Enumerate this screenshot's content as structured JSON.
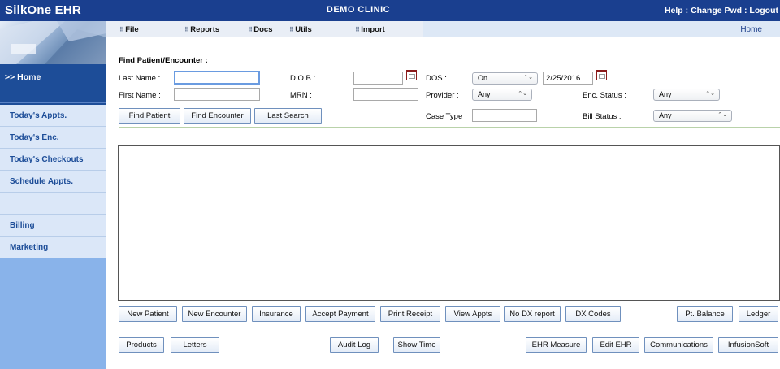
{
  "topbar": {
    "brand": "SilkOne  EHR",
    "clinic": "DEMO  CLINIC",
    "help": "Help",
    "sep1": " : ",
    "change_pwd": "Change Pwd",
    "sep2": " : ",
    "logout": "Logout"
  },
  "menubar": {
    "items": [
      "File",
      "Reports",
      "Docs",
      "Utils",
      "Import"
    ],
    "home": "Home"
  },
  "sidebar": {
    "home": ">> Home",
    "items": [
      "Today's Appts.",
      "Today's Enc.",
      "Today's Checkouts",
      "Schedule Appts.",
      "",
      "Billing",
      "Marketing"
    ]
  },
  "form": {
    "title": "Find Patient/Encounter :",
    "last_name_label": "Last Name :",
    "first_name_label": "First Name :",
    "dob_label": "D O B :",
    "mrn_label": "MRN :",
    "dos_label": "DOS :",
    "dos_mode": "On",
    "dos_date": "2/25/2016",
    "provider_label": "Provider :",
    "provider_value": "Any",
    "enc_status_label": "Enc. Status :",
    "enc_status_value": "Any",
    "case_type_label": "Case Type",
    "bill_status_label": "Bill Status :",
    "bill_status_value": "Any",
    "find_patient": "Find Patient",
    "find_encounter": "Find Encounter",
    "last_search": "Last Search"
  },
  "actions_row1": [
    "New Patient",
    "New Encounter",
    "Insurance",
    "Accept Payment",
    "Print Receipt",
    "View Appts",
    "No DX report",
    "DX Codes",
    "Pt. Balance",
    "Ledger"
  ],
  "actions_row2": [
    "Products",
    "Letters",
    "Audit Log",
    "Show Time",
    "EHR Measure",
    "Edit EHR",
    "Communications",
    "InfusionSoft"
  ],
  "icons": {
    "calendar": "calendar-icon",
    "menu_dots": "grid-dots-icon",
    "dropdown": "chevron-down-icon"
  },
  "colors": {
    "topbar": "#1a3f8f",
    "sidebar": "#89b3ea",
    "sidebar_active": "#1d4d98",
    "calendar": "#8a1b1b"
  }
}
